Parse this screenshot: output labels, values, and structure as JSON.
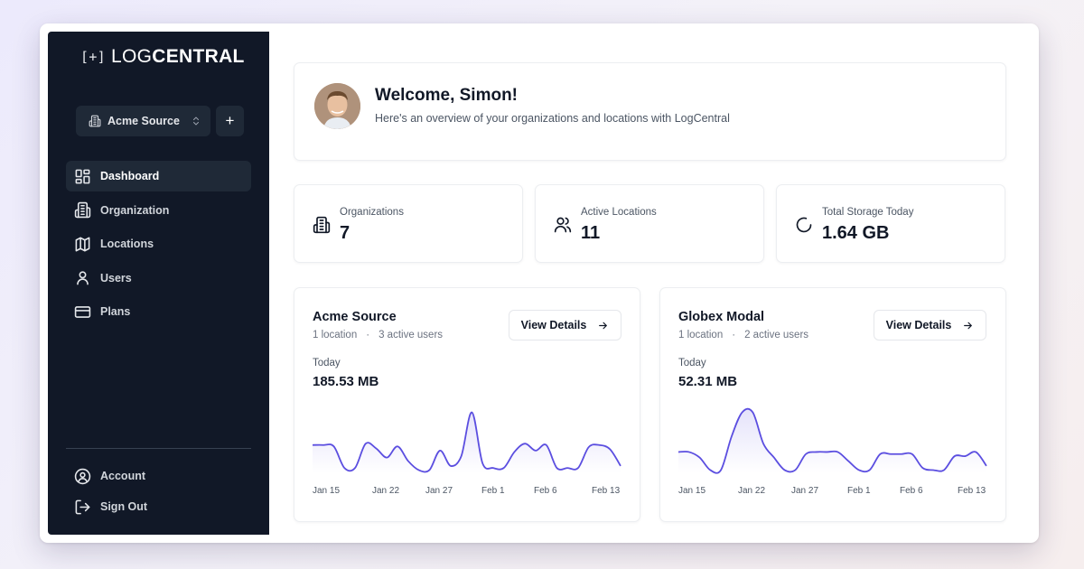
{
  "app": {
    "logo_part1": "LOG",
    "logo_part2": "CENTRAL",
    "logo_icon": "bracket-plus-icon"
  },
  "sidebar": {
    "org_switcher": {
      "label": "Acme Source",
      "icon": "building-icon"
    },
    "add_label": "+",
    "items": [
      {
        "label": "Dashboard",
        "icon": "dashboard-icon",
        "active": true
      },
      {
        "label": "Organization",
        "icon": "building-icon"
      },
      {
        "label": "Locations",
        "icon": "map-icon"
      },
      {
        "label": "Users",
        "icon": "user-icon"
      },
      {
        "label": "Plans",
        "icon": "card-icon"
      }
    ],
    "bottom_items": [
      {
        "label": "Account",
        "icon": "account-icon"
      },
      {
        "label": "Sign Out",
        "icon": "sign-out-icon"
      }
    ]
  },
  "welcome": {
    "title": "Welcome, Simon!",
    "subtitle": "Here's an overview of your organizations and locations with LogCentral"
  },
  "stats": [
    {
      "label": "Organizations",
      "value": "7",
      "icon": "building-icon"
    },
    {
      "label": "Active Locations",
      "value": "11",
      "icon": "users-icon"
    },
    {
      "label": "Total Storage Today",
      "value": "1.64 GB",
      "icon": "spinner-icon"
    }
  ],
  "orgs": [
    {
      "name": "Acme Source",
      "locations": "1 location",
      "users": "3 active users",
      "button": "View Details",
      "today_label": "Today",
      "today_value": "185.53 MB",
      "x_ticks": [
        "Jan 15",
        "Jan 22",
        "Jan 27",
        "Feb 1",
        "Feb 6",
        "Feb 13"
      ],
      "series": [
        0.38,
        0.38,
        0.36,
        0.05,
        0.05,
        0.4,
        0.33,
        0.2,
        0.36,
        0.15,
        0.02,
        0.02,
        0.3,
        0.08,
        0.22,
        0.85,
        0.12,
        0.05,
        0.05,
        0.28,
        0.4,
        0.3,
        0.38,
        0.05,
        0.05,
        0.05,
        0.35,
        0.38,
        0.32,
        0.08
      ],
      "color": "#5b4ee0"
    },
    {
      "name": "Globex Modal",
      "locations": "1 location",
      "users": "2 active users",
      "button": "View Details",
      "today_label": "Today",
      "today_value": "52.31 MB",
      "x_ticks": [
        "Jan 15",
        "Jan 22",
        "Jan 27",
        "Feb 1",
        "Feb 6",
        "Feb 13"
      ],
      "series": [
        0.28,
        0.28,
        0.2,
        0.02,
        0.02,
        0.5,
        0.85,
        0.85,
        0.4,
        0.2,
        0.02,
        0.02,
        0.25,
        0.28,
        0.28,
        0.28,
        0.15,
        0.02,
        0.02,
        0.25,
        0.25,
        0.25,
        0.25,
        0.05,
        0.02,
        0.02,
        0.22,
        0.22,
        0.28,
        0.08
      ],
      "color": "#5b4ee0"
    }
  ]
}
